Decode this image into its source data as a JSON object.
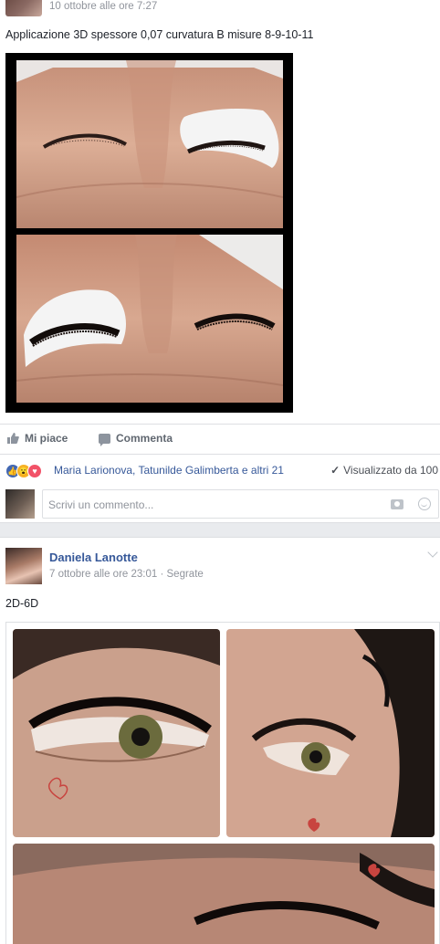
{
  "post1": {
    "timestamp": "10 ottobre alle ore 7:27",
    "text": "Applicazione 3D spessore 0,07 curvatura B misure 8-9-10-11",
    "actions": {
      "like_label": "Mi piace",
      "comment_label": "Commenta"
    },
    "reactions": {
      "icons": [
        "like-reaction",
        "wow-reaction",
        "love-reaction"
      ],
      "names": "Maria Larionova, Tatunilde Galimberta e altri 21",
      "seen_label": "Visualizzato da 100"
    },
    "comment_box": {
      "placeholder": "Scrivi un commento..."
    }
  },
  "post2": {
    "author": "Daniela Lanotte",
    "timestamp": "7 ottobre alle ore 23:01",
    "audience": "Segrate",
    "separator": " · ",
    "text": "2D-6D"
  },
  "colors": {
    "link": "#365899",
    "meta": "#90949c",
    "background": "#e9ebee",
    "like_blue": "#4267b2"
  }
}
